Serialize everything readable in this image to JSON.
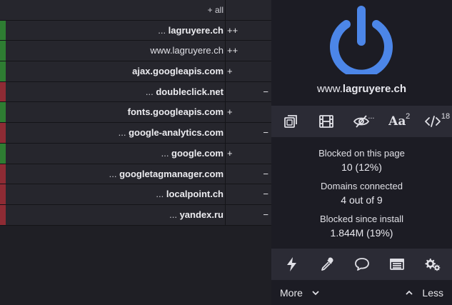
{
  "firewall": {
    "header": {
      "label": "+ all"
    },
    "rows": [
      {
        "lead": "... ",
        "domain": "lagruyere.ch",
        "bold": true,
        "allow": "++",
        "block": "",
        "color": "#2e7d32"
      },
      {
        "lead": "",
        "domain": "www.lagruyere.ch",
        "bold": false,
        "allow": "++",
        "block": "",
        "color": "#2e7d32"
      },
      {
        "lead": "",
        "domain": "ajax.googleapis.com",
        "bold": true,
        "allow": "+",
        "block": "",
        "color": "#2e7d32"
      },
      {
        "lead": "... ",
        "domain": "doubleclick.net",
        "bold": true,
        "allow": "",
        "block": "−",
        "color": "#8e2b34"
      },
      {
        "lead": "",
        "domain": "fonts.googleapis.com",
        "bold": true,
        "allow": "+",
        "block": "",
        "color": "#2e7d32"
      },
      {
        "lead": "... ",
        "domain": "google-analytics.com",
        "bold": true,
        "allow": "",
        "block": "−",
        "color": "#8e2b34"
      },
      {
        "lead": "... ",
        "domain": "google.com",
        "bold": true,
        "allow": "+",
        "block": "",
        "color": "#2e7d32"
      },
      {
        "lead": "... ",
        "domain": "googletagmanager.com",
        "bold": true,
        "allow": "",
        "block": "−",
        "color": "#8e2b34"
      },
      {
        "lead": "... ",
        "domain": "localpoint.ch",
        "bold": true,
        "allow": "",
        "block": "−",
        "color": "#8e2b34"
      },
      {
        "lead": "... ",
        "domain": "yandex.ru",
        "bold": true,
        "allow": "",
        "block": "−",
        "color": "#8e2b34"
      }
    ]
  },
  "panel": {
    "hostname_prefix": "www.",
    "hostname_domain": "lagruyere.ch",
    "accent_color": "#4c86e8",
    "toolbar1": {
      "popup_icon": "no-popups-icon",
      "media_icon": "film-icon",
      "cosmetic_icon": "eye-slash-icon",
      "cosmetic_badge": "...",
      "fonts_icon": "aa-fonts-icon",
      "fonts_label": "Aa",
      "fonts_badge": "2",
      "scripts_icon": "code-icon",
      "scripts_badge": "18"
    },
    "stats": {
      "blocked_page_label": "Blocked on this page",
      "blocked_page_value": "10 (12%)",
      "domains_label": "Domains connected",
      "domains_value": "4 out of 9",
      "blocked_install_label": "Blocked since install",
      "blocked_install_value": "1.844M (19%)"
    },
    "toolbar2": {
      "zapper_icon": "lightning-icon",
      "picker_icon": "eyedropper-icon",
      "report_icon": "speech-bubble-icon",
      "logger_icon": "list-window-icon",
      "dashboard_icon": "gears-icon"
    },
    "footer": {
      "more_label": "More",
      "less_label": "Less"
    }
  }
}
